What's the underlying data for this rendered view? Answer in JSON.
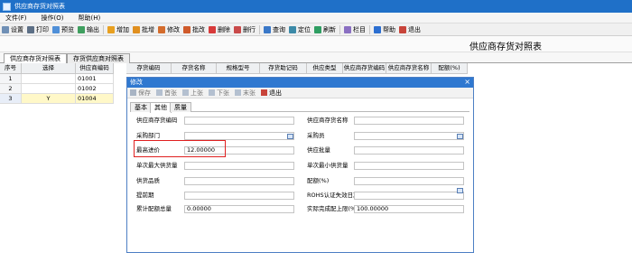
{
  "window": {
    "title": "供应商存货对照表"
  },
  "menu": {
    "items": [
      "文件(F)",
      "操作(O)",
      "帮助(H)"
    ]
  },
  "toolbar": {
    "items": [
      {
        "label": "设置",
        "icon": "settings-icon",
        "color": "#6f8fb5"
      },
      {
        "label": "打印",
        "icon": "print-icon",
        "color": "#5c6f86"
      },
      {
        "label": "预览",
        "icon": "preview-icon",
        "color": "#4f8fd8"
      },
      {
        "label": "输出",
        "icon": "export-icon",
        "color": "#3f9f5f"
      },
      {
        "label": "增加",
        "icon": "add-icon",
        "color": "#e8a020"
      },
      {
        "label": "批增",
        "icon": "batch-add-icon",
        "color": "#e08f1f"
      },
      {
        "label": "修改",
        "icon": "edit-icon",
        "color": "#d46c2c"
      },
      {
        "label": "批改",
        "icon": "batch-edit-icon",
        "color": "#cf5a2a"
      },
      {
        "label": "删除",
        "icon": "delete-icon",
        "color": "#d83a3a"
      },
      {
        "label": "删行",
        "icon": "delete-row-icon",
        "color": "#c94a4a"
      },
      {
        "label": "查询",
        "icon": "query-icon",
        "color": "#3a78c8"
      },
      {
        "label": "定位",
        "icon": "locate-icon",
        "color": "#3c8aa8"
      },
      {
        "label": "刷新",
        "icon": "refresh-icon",
        "color": "#2f9e62"
      },
      {
        "label": "栏目",
        "icon": "columns-icon",
        "color": "#8a6fc2"
      },
      {
        "label": "帮助",
        "icon": "help-icon",
        "color": "#2c6fd1"
      },
      {
        "label": "退出",
        "icon": "exit-icon",
        "color": "#c8443a"
      }
    ]
  },
  "page": {
    "title": "供应商存货对照表"
  },
  "tabs": [
    "供应商存货对照表",
    "存货供应商对照表"
  ],
  "grid": {
    "headers": [
      "序号",
      "选择",
      "供应商编码",
      "存货编码",
      "存货名称",
      "规格型号",
      "存货助记码",
      "供应类型",
      "供应商存货编码",
      "供应商存货名称",
      "配额(%)"
    ],
    "rows": [
      {
        "index": "1",
        "select": "",
        "vendor_code": "01001"
      },
      {
        "index": "2",
        "select": "",
        "vendor_code": "01002"
      },
      {
        "index": "3",
        "select": "Y",
        "vendor_code": "01004"
      }
    ]
  },
  "dialog": {
    "title": "修改",
    "toolbar": [
      "保存",
      "首张",
      "上张",
      "下张",
      "末张",
      "退出"
    ],
    "tabs": [
      "基本",
      "其他",
      "质量"
    ],
    "fields": {
      "vendor_inv_code": {
        "label": "供应商存货编码",
        "value": ""
      },
      "vendor_inv_name": {
        "label": "供应商存货名称",
        "value": ""
      },
      "purchase_dept": {
        "label": "采购部门",
        "value": ""
      },
      "purchaser": {
        "label": "采购员",
        "value": ""
      },
      "max_price": {
        "label": "最高进价",
        "value": "12.00000"
      },
      "supply_batch": {
        "label": "供应批量",
        "value": ""
      },
      "max_supply_qty": {
        "label": "单次最大供货量",
        "value": ""
      },
      "min_supply_qty": {
        "label": "单次最小供货量",
        "value": ""
      },
      "supply_quality": {
        "label": "供货品质",
        "value": ""
      },
      "quota": {
        "label": "配额(%)",
        "value": ""
      },
      "lead_time": {
        "label": "提前期",
        "value": ""
      },
      "rohs_expiry": {
        "label": "ROHS认证失效日期",
        "value": ""
      },
      "cum_quota": {
        "label": "累计配额总量",
        "value": "0.00000"
      },
      "actual_limit": {
        "label": "实际完成配上限(%)",
        "value": "100.00000"
      }
    }
  }
}
